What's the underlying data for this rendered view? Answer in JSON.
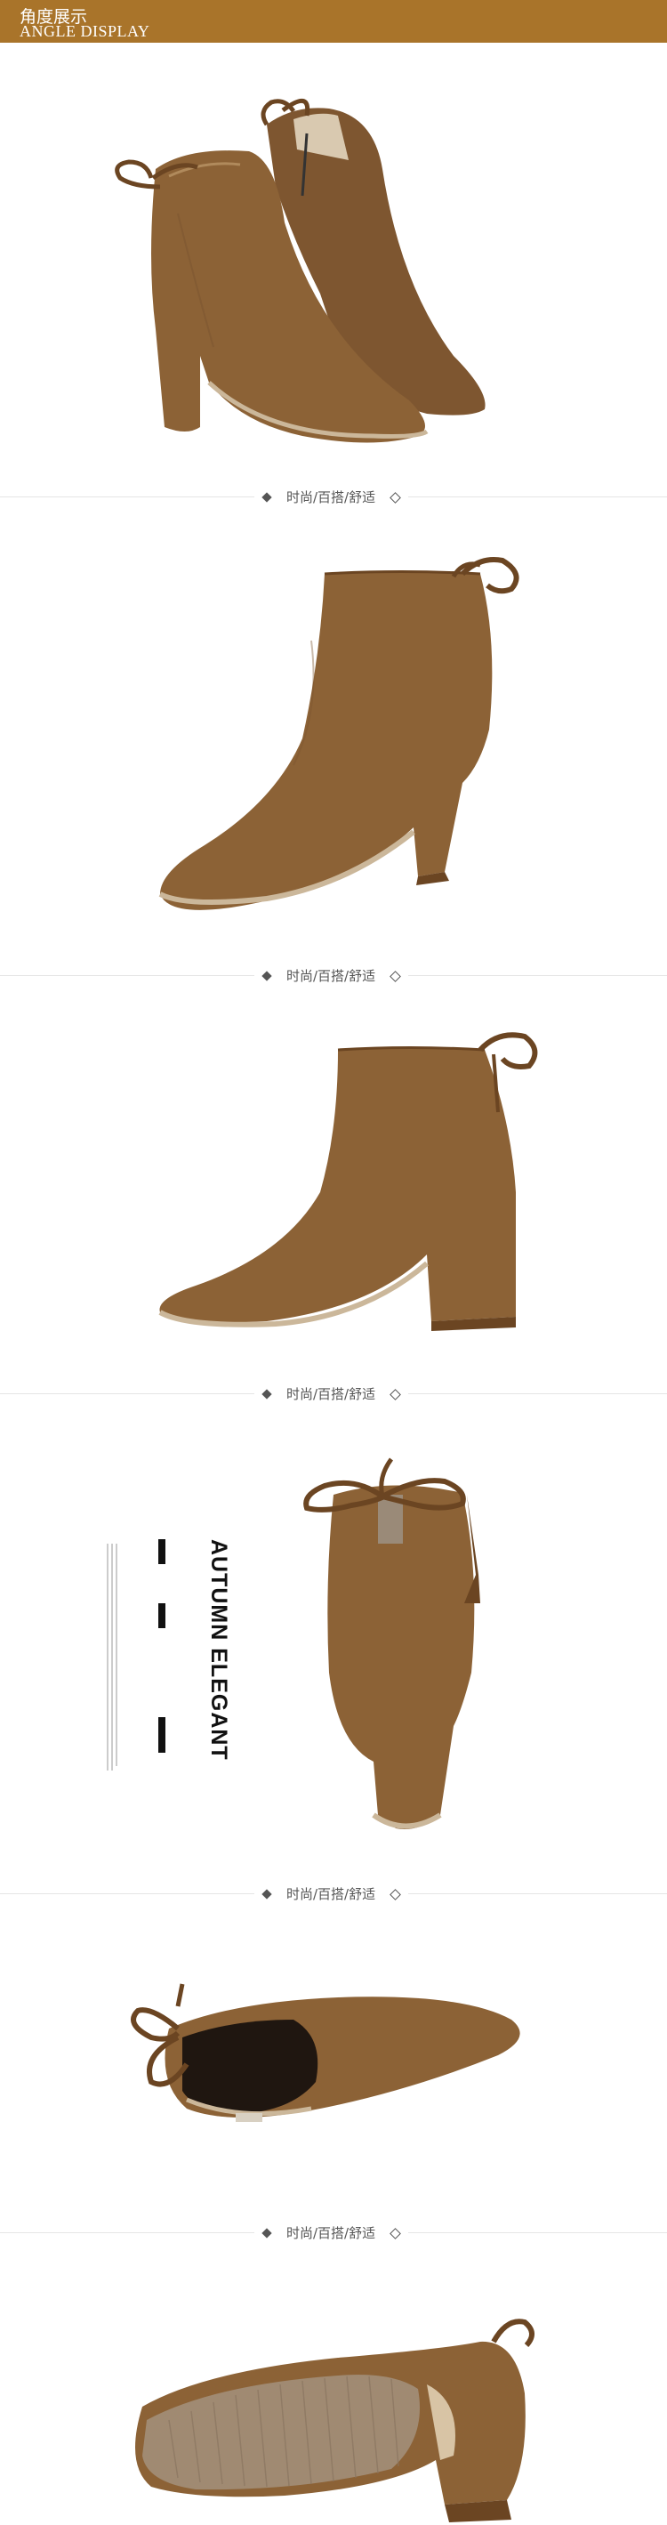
{
  "header": {
    "title_cn": "角度展示",
    "title_en": "ANGLE DISPLAY"
  },
  "dividers": [
    {
      "label": "时尚/百搭/舒适"
    },
    {
      "label": "时尚/百搭/舒适"
    },
    {
      "label": "时尚/百搭/舒适"
    },
    {
      "label": "时尚/百搭/舒适"
    },
    {
      "label": "时尚/百搭/舒适"
    }
  ],
  "side_text": {
    "title": "AUTUMN ELEGANT"
  },
  "colors": {
    "header_bg": "#a9742a",
    "suede": "#8c6236",
    "suede_dark": "#6b4522",
    "sole": "#cbb79a"
  },
  "photos": [
    {
      "name": "pair-front-angle"
    },
    {
      "name": "side-view-left"
    },
    {
      "name": "side-view-right"
    },
    {
      "name": "back-view"
    },
    {
      "name": "top-view"
    },
    {
      "name": "sole-view"
    }
  ]
}
